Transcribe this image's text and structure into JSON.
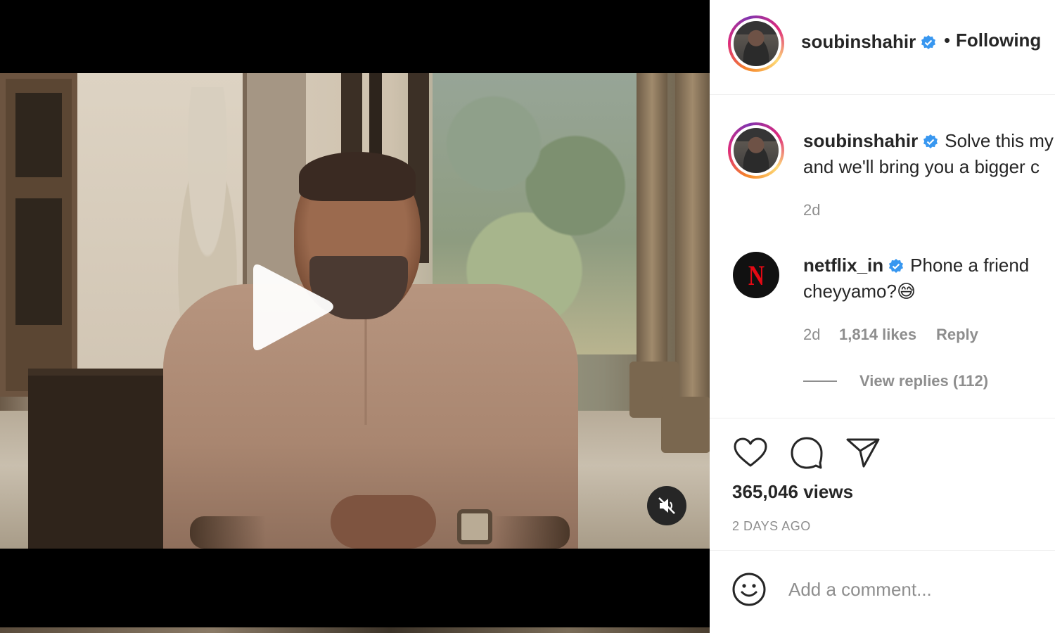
{
  "post": {
    "username": "soubinshahir",
    "follow_state": "Following",
    "separator": "•"
  },
  "caption": {
    "username": "soubinshahir",
    "line1": "Solve this my",
    "line2": "and we'll bring you a bigger c",
    "time": "2d"
  },
  "comment": {
    "username": "netflix_in",
    "text_line1": "Phone a friend",
    "text_line2": "cheyyamo?",
    "emoji": "😅",
    "time": "2d",
    "likes": "1,814 likes",
    "reply_label": "Reply",
    "view_replies": "View replies (112)",
    "avatar_letter": "N"
  },
  "stats": {
    "views": "365,046 views",
    "time_ago": "2 DAYS AGO"
  },
  "add_comment": {
    "placeholder": "Add a comment..."
  },
  "icons": {
    "play": "play-icon",
    "mute": "muted-speaker-icon",
    "like": "heart-icon",
    "comment": "comment-bubble-icon",
    "share": "paper-plane-icon",
    "emoji": "smiley-icon",
    "verified": "verified-badge-icon"
  },
  "colors": {
    "verified_blue": "#3897f0",
    "netflix_red": "#e50914",
    "text_primary": "#262626",
    "text_secondary": "#8e8e8e"
  }
}
